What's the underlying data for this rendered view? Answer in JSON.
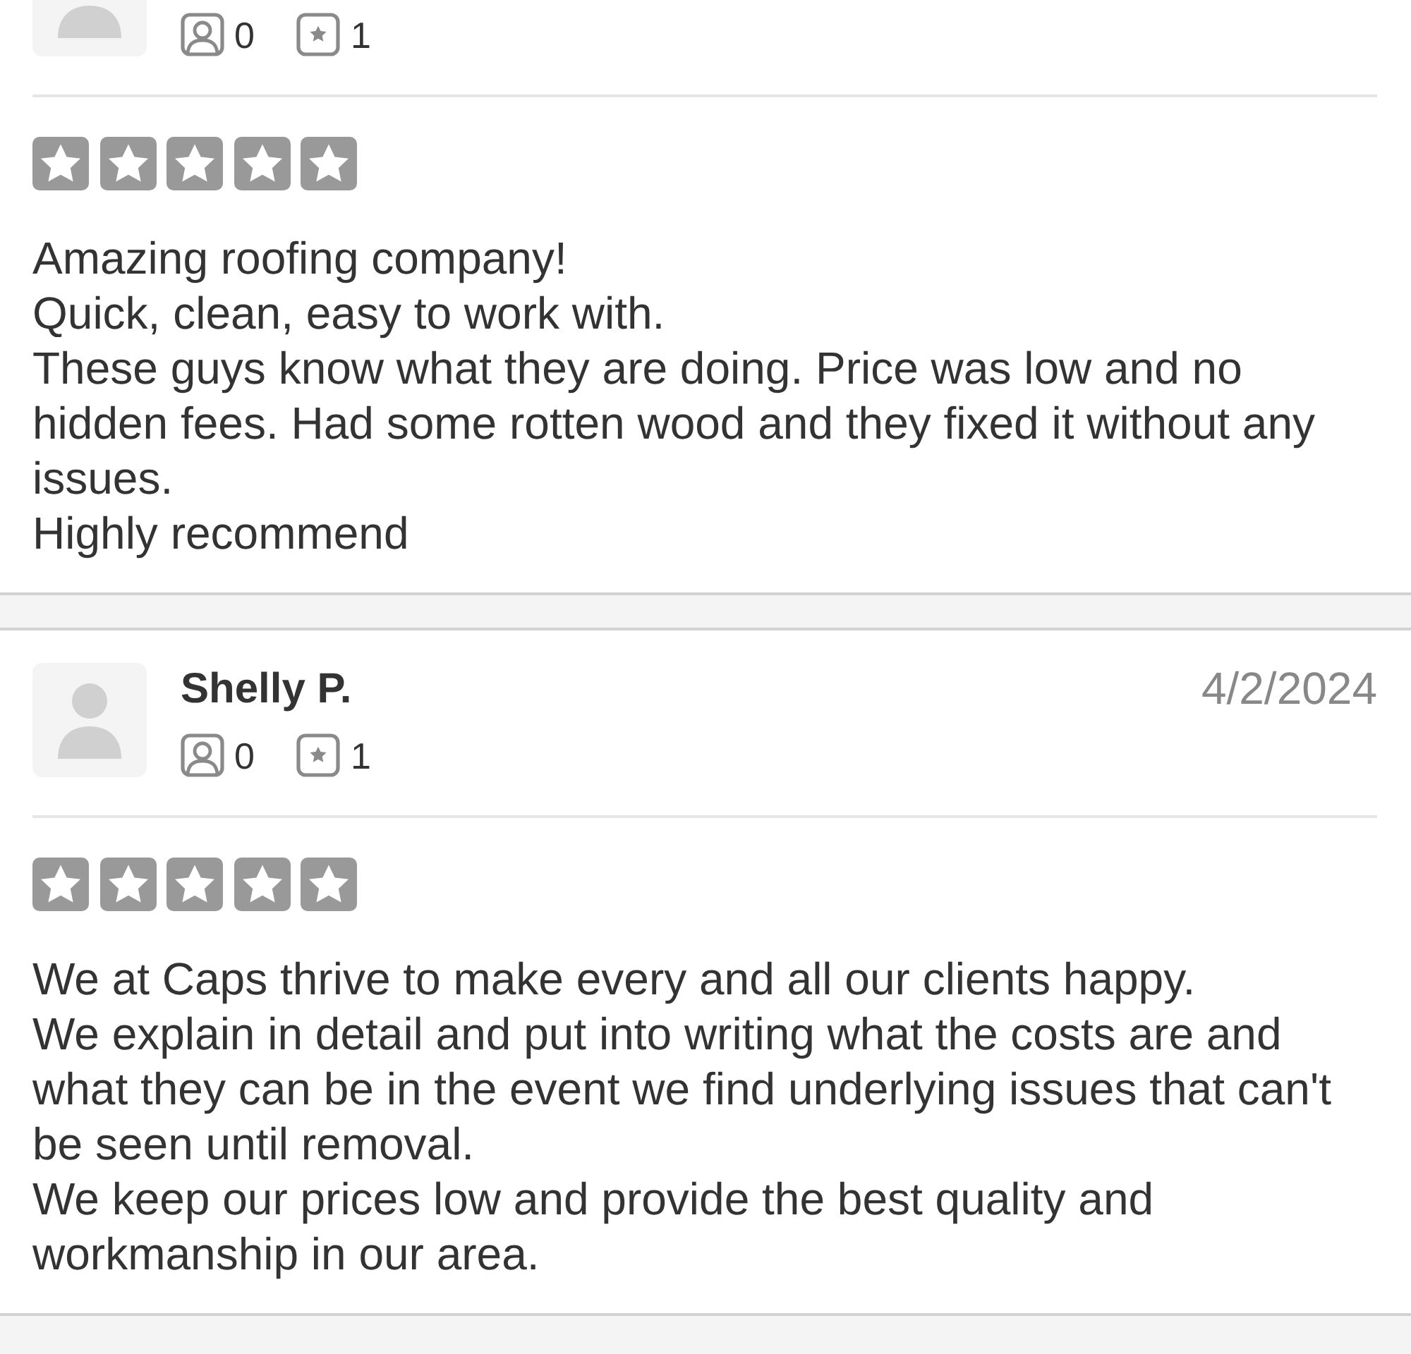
{
  "reviews": [
    {
      "stats": [
        {
          "kind": "person",
          "value": "0"
        },
        {
          "kind": "star",
          "value": "1"
        }
      ],
      "text": "Amazing roofing company!\nQuick, clean, easy to work with.\nThese guys know what they are doing. Price was low and no hidden fees. Had some rotten wood and they fixed it without any issues.\nHighly recommend"
    },
    {
      "name": "Shelly P.",
      "date": "4/2/2024",
      "stats": [
        {
          "kind": "person",
          "value": "0"
        },
        {
          "kind": "star",
          "value": "1"
        }
      ],
      "text": "We at Caps thrive to make every and all our clients happy.\nWe explain in detail and put into writing what the costs are and what they can be in the event we find underlying issues that can't be seen until removal.\nWe keep our prices low and provide the best quality and workmanship in our area."
    }
  ]
}
